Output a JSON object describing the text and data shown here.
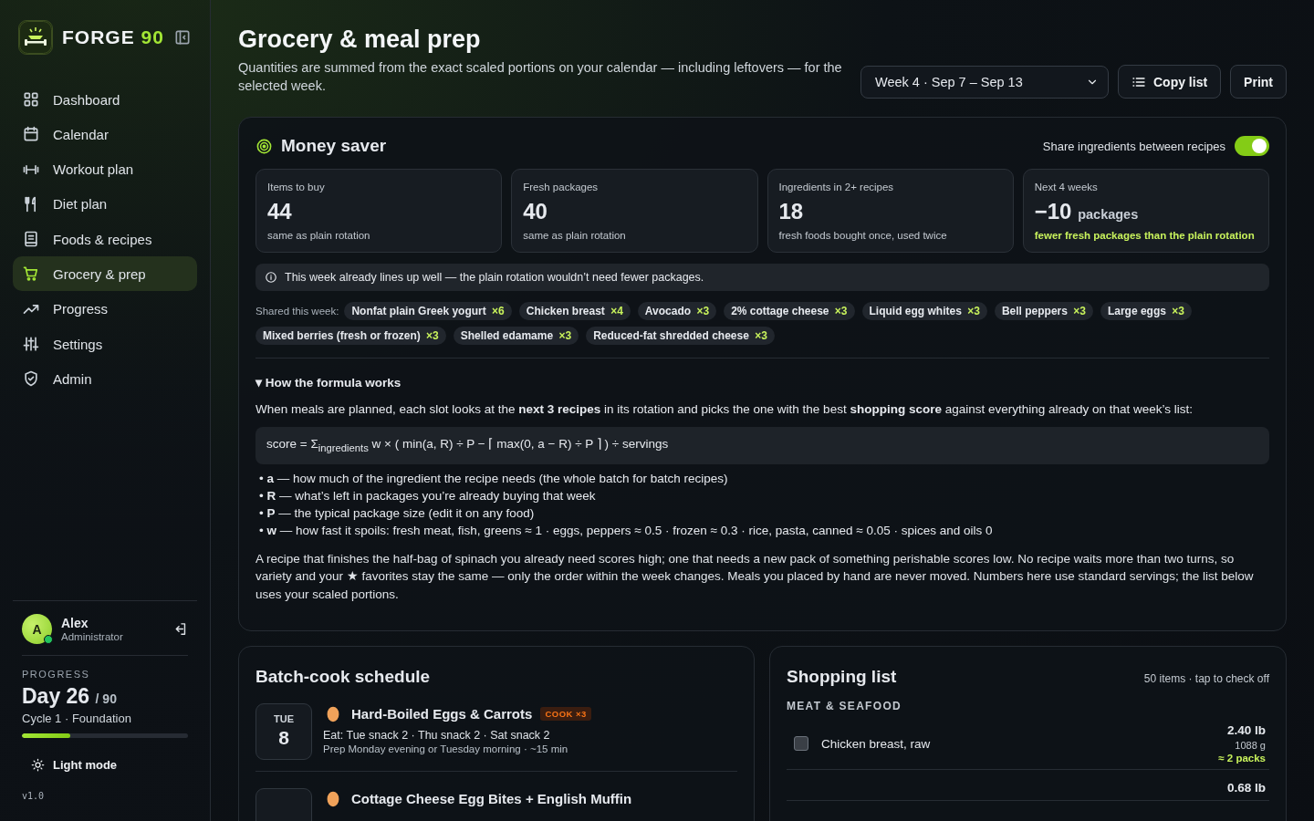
{
  "brand": {
    "name": "FORGE",
    "accent": "90"
  },
  "nav": [
    {
      "label": "Dashboard",
      "selected": false
    },
    {
      "label": "Calendar",
      "selected": false
    },
    {
      "label": "Workout plan",
      "selected": false
    },
    {
      "label": "Diet plan",
      "selected": false
    },
    {
      "label": "Foods & recipes",
      "selected": false
    },
    {
      "label": "Grocery & prep",
      "selected": true
    },
    {
      "label": "Progress",
      "selected": false
    },
    {
      "label": "Settings",
      "selected": false
    },
    {
      "label": "Admin",
      "selected": false
    }
  ],
  "user": {
    "initial": "A",
    "name": "Alex",
    "role": "Administrator",
    "online": true
  },
  "progress": {
    "label": "PROGRESS",
    "day": "Day 26",
    "total": "/ 90",
    "cycle": "Cycle 1 · Foundation",
    "level": 0.29
  },
  "theme_button": "Light mode",
  "version": "v1.0",
  "header": {
    "title": "Grocery & meal prep",
    "subtitle": "Quantities are summed from the exact scaled portions on your calendar — including leftovers — for the selected week.",
    "week": "Week 4 · Sep 7 – Sep 13",
    "copy_button": "Copy list",
    "print_button": "Print"
  },
  "money_saver": {
    "title": "Money saver",
    "toggle": {
      "label": "Share ingredients between recipes",
      "on": true
    },
    "stats": [
      {
        "label": "Items to buy",
        "value": "44",
        "note": "same as plain rotation",
        "highlight": false
      },
      {
        "label": "Fresh packages",
        "value": "40",
        "note": "same as plain rotation",
        "highlight": false
      },
      {
        "label": "Ingredients in 2+ recipes",
        "value": "18",
        "note": "fresh foods bought once, used twice",
        "highlight": false
      },
      {
        "label": "Next 4 weeks",
        "value": "−10",
        "unit": "packages",
        "note": "fewer fresh packages than the plain rotation",
        "highlight": true
      }
    ],
    "info": "This week already lines up well — the plain rotation wouldn’t need fewer packages.",
    "shared_label": "Shared this week:",
    "shared": [
      {
        "name": "Nonfat plain Greek yogurt",
        "count": "×6"
      },
      {
        "name": "Chicken breast",
        "count": "×4"
      },
      {
        "name": "Avocado",
        "count": "×3"
      },
      {
        "name": "2% cottage cheese",
        "count": "×3"
      },
      {
        "name": "Liquid egg whites",
        "count": "×3"
      },
      {
        "name": "Bell peppers",
        "count": "×3"
      },
      {
        "name": "Large eggs",
        "count": "×3"
      },
      {
        "name": "Mixed berries (fresh or frozen)",
        "count": "×3"
      },
      {
        "name": "Shelled edamame",
        "count": "×3"
      },
      {
        "name": "Reduced-fat shredded cheese",
        "count": "×3"
      }
    ],
    "formula": {
      "summary": "▾ How the formula works",
      "intro": "When meals are planned, each slot looks at the **next 3 recipes** in its rotation and picks the one with the best **shopping score** against everything already on that week’s list:",
      "equation": "score = Σ$_{ingredients}$ w × ( min(a, R) ÷ P − ⌈ max(0, a − R) ÷ P ⌉ ) ÷ servings",
      "bullets": [
        "• **a** — how much of the ingredient the recipe needs (the whole batch for batch recipes)",
        "• **R** — what’s left in packages you’re already buying that week",
        "• **P** — the typical package size (edit it on any food)",
        "• **w** — how fast it spoils: fresh meat, fish, greens ≈ 1 · eggs, peppers ≈ 0.5 · frozen ≈ 0.3 · rice, pasta, canned ≈ 0.05 · spices and oils 0"
      ],
      "note": "A recipe that finishes the half-bag of spinach you already need scores high; one that needs a new pack of something perishable scores low. No recipe waits more than two turns, so variety and your ★ favorites stay the same — only the order within the week changes. Meals you placed by hand are never moved. Numbers here use standard servings; the list below uses your scaled portions."
    }
  },
  "batch": {
    "title": "Batch-cook schedule",
    "rows": [
      {
        "dow": "TUE",
        "day": "8",
        "title": "Hard-Boiled Eggs & Carrots",
        "badge": "COOK ×3",
        "eat": "Eat: Tue snack 2 · Thu snack 2 · Sat snack 2",
        "prep": "Prep Monday evening or Tuesday morning · ~15 min"
      },
      {
        "title": "Cottage Cheese Egg Bites + English Muffin"
      }
    ]
  },
  "shopping": {
    "title": "Shopping list",
    "meta": "50 items · tap to check off",
    "section": "MEAT & SEAFOOD",
    "items": [
      {
        "name": "Chicken breast, raw",
        "checked": false,
        "qty": "2.40 lb",
        "grams": "1088 g",
        "packs": "≈ 2 packs"
      },
      {
        "qty": "0.68 lb"
      }
    ]
  }
}
